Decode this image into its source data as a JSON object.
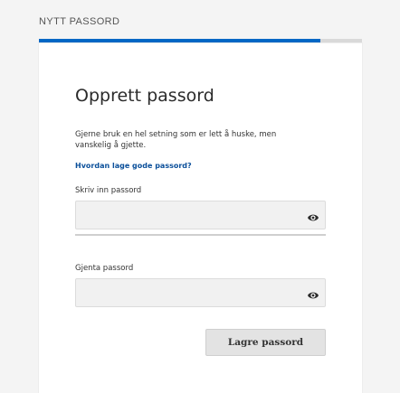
{
  "header": {
    "section_label": "NYTT PASSORD",
    "progress_fraction": 0.87
  },
  "card": {
    "title": "Opprett passord",
    "description": "Gjerne bruk en hel setning som er lett å huske, men vanskelig å gjette.",
    "help_link": "Hvordan lage gode passord?"
  },
  "fields": [
    {
      "label": "Skriv inn passord",
      "value": "",
      "icon": "eye-icon"
    },
    {
      "label": "Gjenta passord",
      "value": "",
      "icon": "eye-icon"
    }
  ],
  "actions": {
    "save_label": "Lagre passord"
  },
  "colors": {
    "progress": "#0067c5",
    "link": "#0a4f9a",
    "background": "#f4f4f4"
  }
}
